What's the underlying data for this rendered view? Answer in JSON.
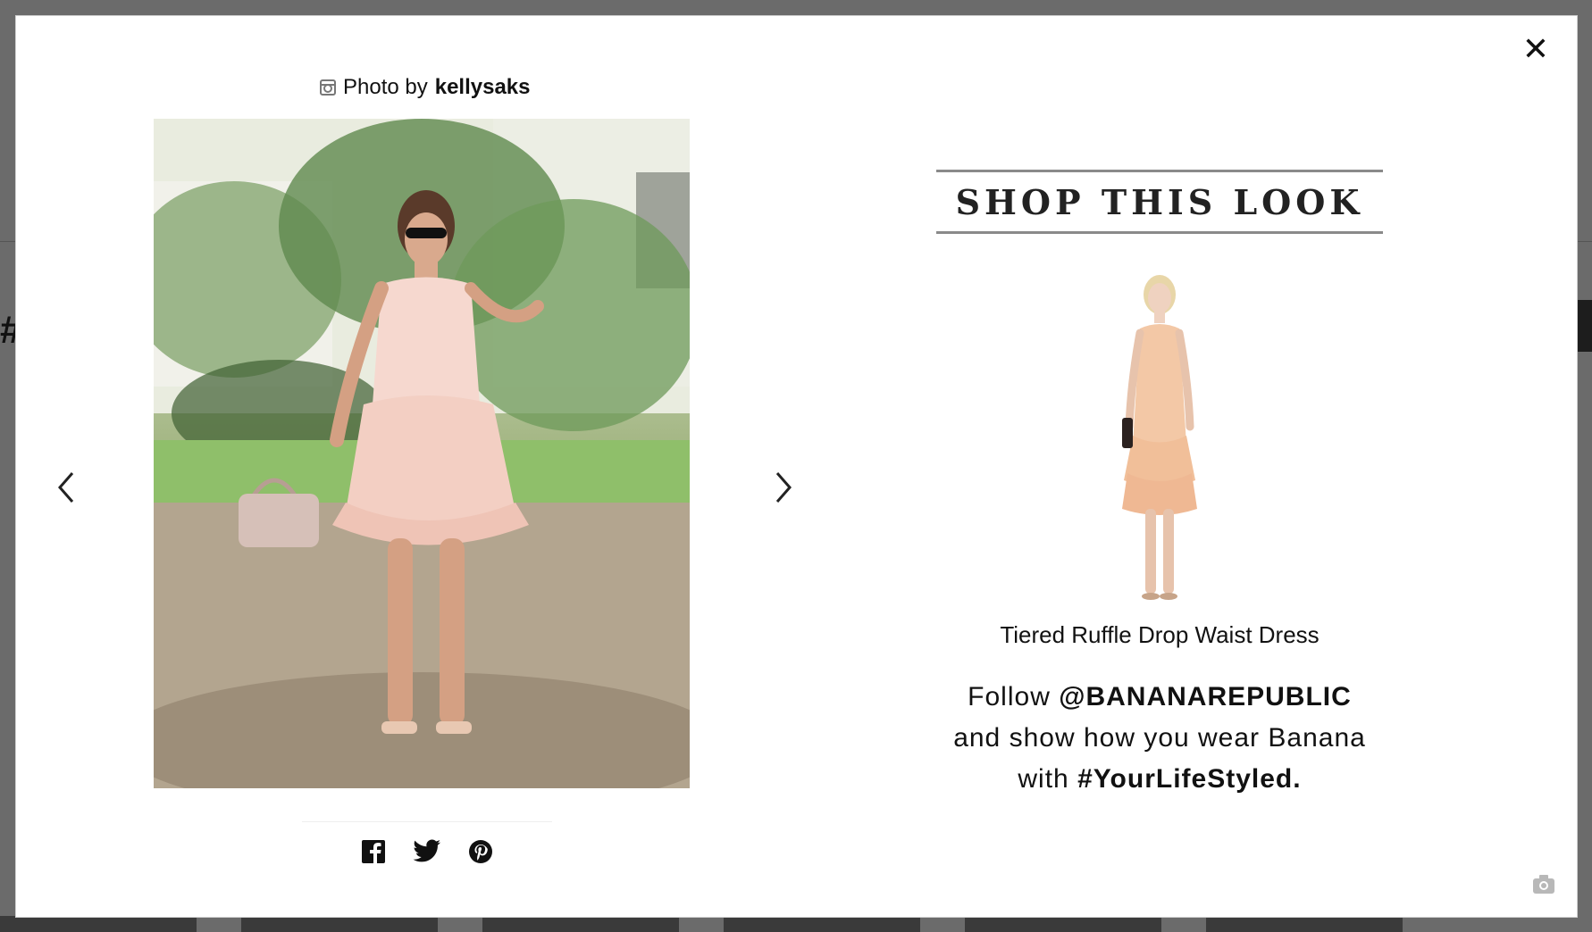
{
  "modal": {
    "close_label": "✕",
    "photo_credit": {
      "prefix": "Photo by",
      "username": "kellysaks"
    },
    "icons": {
      "instagram": "instagram-icon",
      "prev": "chevron-left-icon",
      "next": "chevron-right-icon",
      "facebook": "facebook-icon",
      "twitter": "twitter-icon",
      "pinterest": "pinterest-icon",
      "camera": "camera-icon"
    },
    "shop": {
      "header": "SHOP THIS LOOK",
      "product_name": "Tiered Ruffle Drop Waist Dress",
      "follow_line1_prefix": "Follow",
      "follow_handle": "@BANANAREPUBLIC",
      "follow_line2": "and show how you wear Banana",
      "follow_line3_prefix": "with",
      "hashtag": "#YourLifeStyled."
    }
  },
  "colors": {
    "overlay": "#6b6b6b",
    "modal_bg": "#ffffff",
    "header_rule": "#8a8a8a",
    "text": "#111111"
  }
}
